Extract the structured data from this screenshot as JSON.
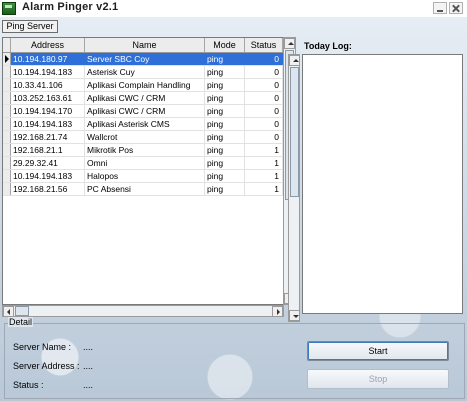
{
  "window": {
    "title": "Alarm Pinger v2.1"
  },
  "tab": {
    "label": "Ping Server"
  },
  "table": {
    "columns": [
      "Address",
      "Name",
      "Mode",
      "Status"
    ],
    "rows": [
      {
        "address": "10.194.180.97",
        "name": "Server SBC Coy",
        "mode": "ping",
        "status": "0"
      },
      {
        "address": "10.194.194.183",
        "name": "Asterisk Cuy",
        "mode": "ping",
        "status": "0"
      },
      {
        "address": "10.33.41.106",
        "name": "Aplikasi Complain Handling",
        "mode": "ping",
        "status": "0"
      },
      {
        "address": "103.252.163.61",
        "name": "Aplikasi CWC / CRM",
        "mode": "ping",
        "status": "0"
      },
      {
        "address": "10.194.194.170",
        "name": "Aplikasi CWC / CRM",
        "mode": "ping",
        "status": "0"
      },
      {
        "address": "10.194.194.183",
        "name": "Aplikasi Asterisk CMS",
        "mode": "ping",
        "status": "0"
      },
      {
        "address": "192.168.21.74",
        "name": "Wallcrot",
        "mode": "ping",
        "status": "0"
      },
      {
        "address": "192.168.21.1",
        "name": "Mikrotik Pos",
        "mode": "ping",
        "status": "1"
      },
      {
        "address": "29.29.32.41",
        "name": "Omni",
        "mode": "ping",
        "status": "1"
      },
      {
        "address": "10.194.194.183",
        "name": "Halopos",
        "mode": "ping",
        "status": "1"
      },
      {
        "address": "192.168.21.56",
        "name": "PC Absensi",
        "mode": "ping",
        "status": "1"
      }
    ]
  },
  "log": {
    "label": "Today Log:"
  },
  "detail": {
    "legend": "Detail",
    "server_name_label": "Server Name :",
    "server_name_value": "....",
    "server_address_label": "Server Address :",
    "server_address_value": "....",
    "status_label": "Status :",
    "status_value": "....",
    "start_label": "Start",
    "stop_label": "Stop"
  },
  "colors": {
    "selection": "#2e6fd8",
    "background": "#c9d6e3"
  }
}
